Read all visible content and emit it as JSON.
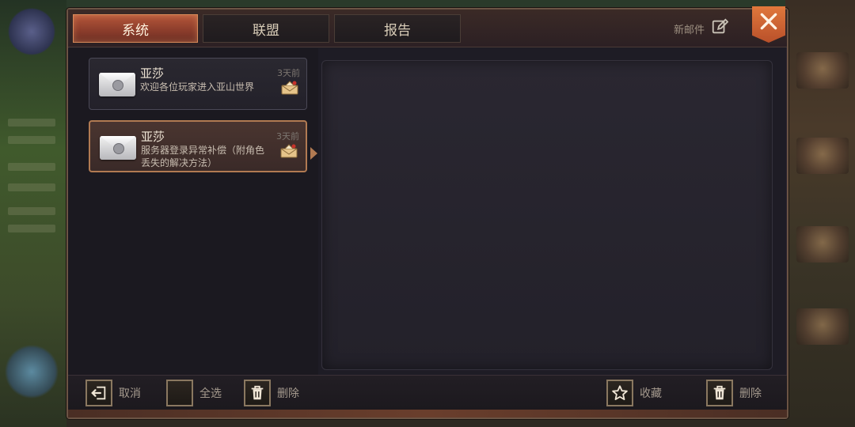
{
  "tabs": [
    {
      "label": "系统",
      "active": true
    },
    {
      "label": "联盟",
      "active": false
    },
    {
      "label": "报告",
      "active": false
    }
  ],
  "new_mail_label": "新邮件",
  "mails": [
    {
      "sender": "亚莎",
      "subject": "欢迎各位玩家进入亚山世界",
      "time": "3天前",
      "selected": false
    },
    {
      "sender": "亚莎",
      "subject": "服务器登录异常补偿（附角色丢失的解决方法）",
      "time": "3天前",
      "selected": true
    }
  ],
  "footer": {
    "cancel_label": "取消",
    "select_all_label": "全选",
    "delete_label": "删除",
    "favorite_label": "收藏",
    "delete_right_label": "删除"
  },
  "icons": {
    "close": "close-icon",
    "edit": "edit-icon",
    "envelope": "envelope-icon",
    "exit": "exit-icon",
    "trash": "trash-icon",
    "star": "star-icon"
  },
  "colors": {
    "accent": "#b4573a",
    "panel": "#1e1c25",
    "border": "#6b5444"
  }
}
